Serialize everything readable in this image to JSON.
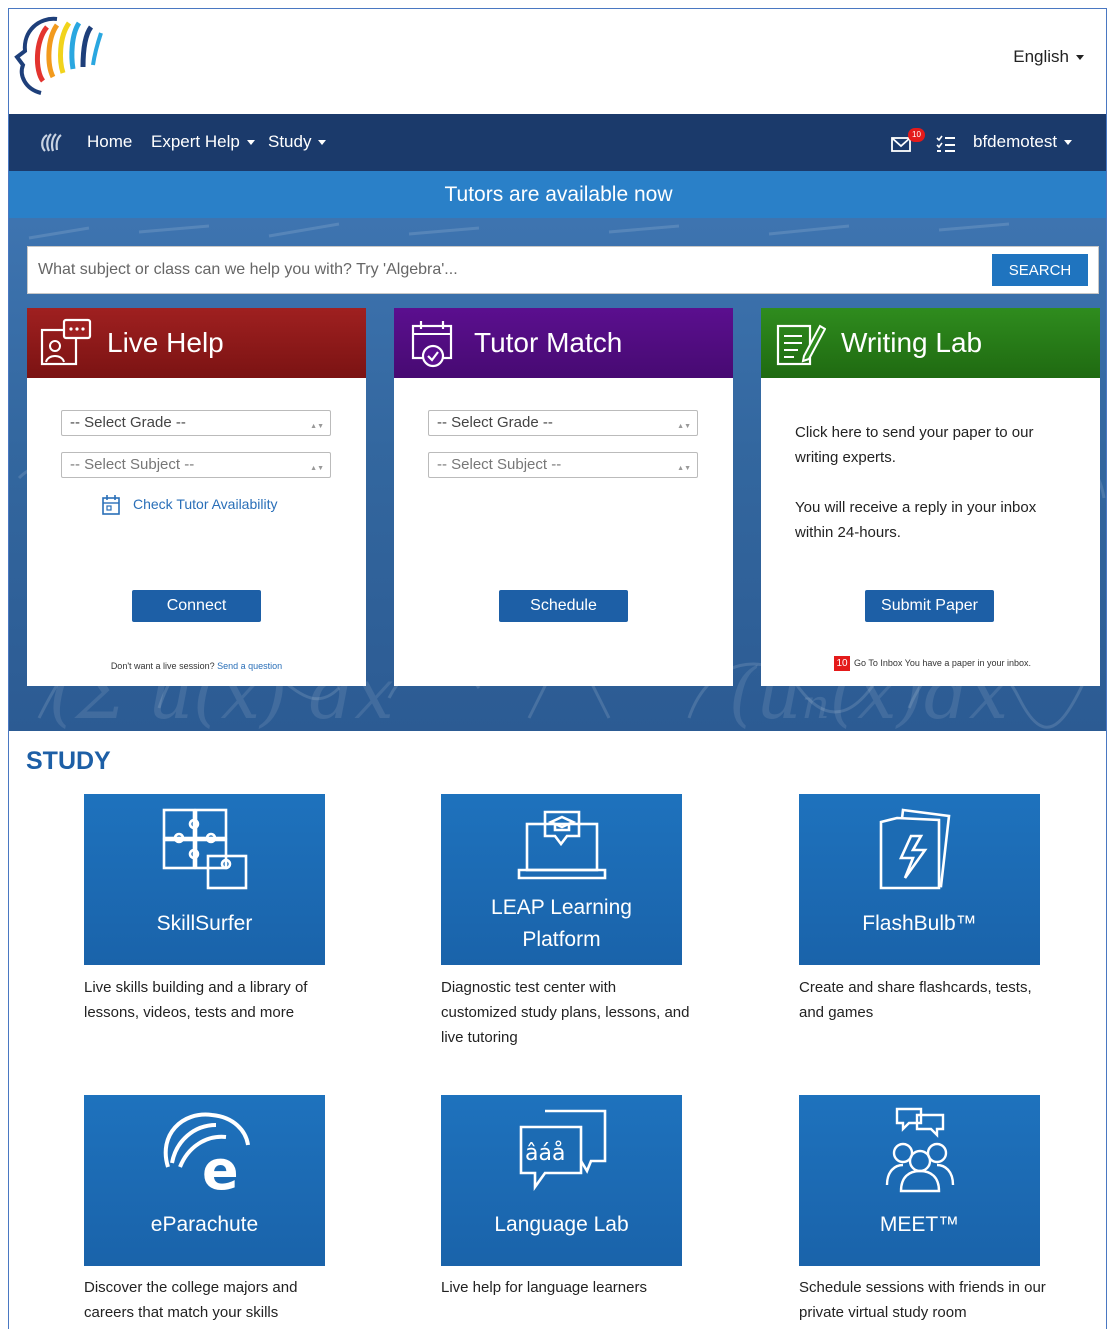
{
  "header": {
    "language": "English"
  },
  "nav": {
    "home": "Home",
    "expert_help": "Expert Help",
    "study": "Study",
    "mail_count": "10",
    "username": "bfdemotest"
  },
  "banner": {
    "text": "Tutors are available now"
  },
  "search": {
    "placeholder": "What subject or class can we help you with? Try 'Algebra'...",
    "button": "SEARCH"
  },
  "live_help": {
    "title": "Live Help",
    "grade_select": "-- Select Grade --",
    "subject_select": "-- Select Subject --",
    "check_link": "Check Tutor Availability",
    "button": "Connect",
    "note": "Don't want a live session?",
    "note_link": "Send a question"
  },
  "tutor_match": {
    "title": "Tutor Match",
    "grade_select": "-- Select Grade --",
    "subject_select": "-- Select Subject --",
    "button": "Schedule"
  },
  "writing_lab": {
    "title": "Writing Lab",
    "text1": "Click here to send your paper to our writing experts.",
    "text2": "You will receive a reply in your inbox within 24-hours.",
    "button": "Submit Paper",
    "inbox_count": "10",
    "inbox_note": "Go To Inbox You have a paper in your inbox."
  },
  "study": {
    "title": "STUDY",
    "tiles": [
      {
        "label": "SkillSurfer",
        "desc": "Live skills building and a library of lessons, videos, tests and more",
        "icon": "puzzle-icon"
      },
      {
        "label": "LEAP Learning Platform",
        "desc": "Diagnostic test center with customized study plans, lessons, and live tutoring",
        "icon": "laptop-graduation-icon"
      },
      {
        "label": "FlashBulb™",
        "desc": "Create and share flashcards, tests, and games",
        "icon": "flashcards-icon"
      },
      {
        "label": "eParachute",
        "desc": "Discover the college majors and careers that match your skills",
        "icon": "parachute-e-icon"
      },
      {
        "label": "Language Lab",
        "desc": "Live help for language learners",
        "icon": "speech-bubbles-icon"
      },
      {
        "label": "MEET™",
        "desc": "Schedule sessions with friends in our private virtual study room",
        "icon": "group-chat-icon"
      }
    ]
  },
  "colors": {
    "navbar": "#1b3a6b",
    "banner": "#2a80c8",
    "live_help": "#9f2020",
    "tutor_match": "#5b0f8f",
    "writing_lab": "#2f8c1e",
    "tile": "#1e72bd"
  }
}
